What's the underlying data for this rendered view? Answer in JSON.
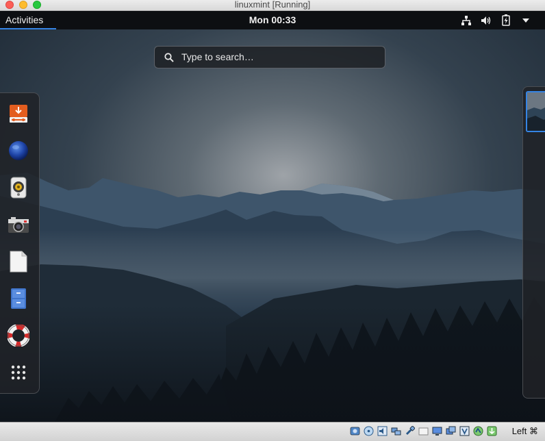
{
  "window": {
    "title": "linuxmint [Running]"
  },
  "topbar": {
    "activities_label": "Activities",
    "clock": "Mon 00:33",
    "tray_icons": [
      "network-wired-icon",
      "volume-icon",
      "battery-charging-icon",
      "system-menu-arrow-icon"
    ]
  },
  "search": {
    "placeholder": "Type to search…"
  },
  "dash": {
    "items": [
      {
        "name": "software-installer",
        "icon": "download-box-icon"
      },
      {
        "name": "web-browser",
        "icon": "globe-icon"
      },
      {
        "name": "music-player",
        "icon": "speaker-icon"
      },
      {
        "name": "screenshot",
        "icon": "camera-icon"
      },
      {
        "name": "text-editor",
        "icon": "document-icon"
      },
      {
        "name": "file-manager",
        "icon": "file-cabinet-icon"
      },
      {
        "name": "help",
        "icon": "lifebuoy-icon"
      },
      {
        "name": "show-applications",
        "icon": "app-grid-icon"
      }
    ]
  },
  "vbox": {
    "status_icons": [
      "hard-disk-icon",
      "optical-disc-icon",
      "audio-icon",
      "network-icon",
      "usb-icon",
      "shared-folders-icon",
      "display-icon",
      "recording-icon",
      "cpu-icon",
      "mouse-integration-icon",
      "keyboard-capture-icon"
    ],
    "host_key": "Left ⌘"
  },
  "colors": {
    "accent": "#3584e4",
    "topbar_bg": "#0d0f12"
  }
}
